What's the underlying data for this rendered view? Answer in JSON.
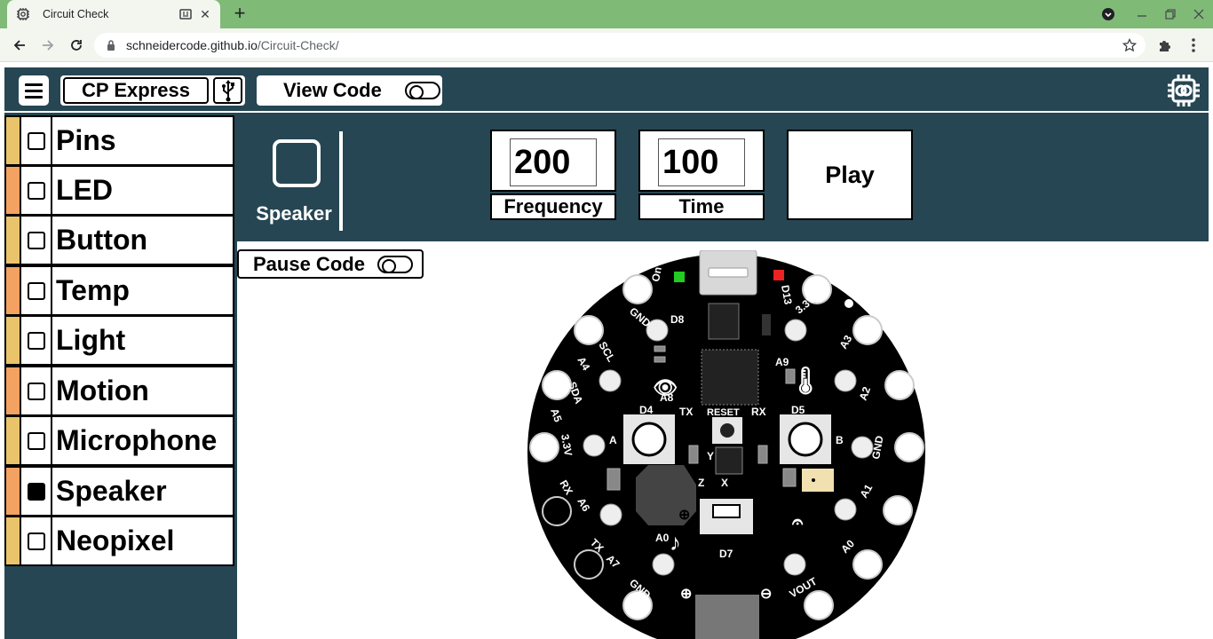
{
  "browser": {
    "tab_title": "Circuit Check",
    "url_host": "schneidercode.github.io",
    "url_path": "/Circuit-Check/"
  },
  "header": {
    "board_label": "CP Express",
    "view_code_label": "View Code",
    "view_code_on": false
  },
  "sidebar": {
    "items": [
      {
        "label": "Pins",
        "checked": false,
        "strip": "#e9c46a"
      },
      {
        "label": "LED",
        "checked": false,
        "strip": "#f4a261"
      },
      {
        "label": "Button",
        "checked": false,
        "strip": "#e9c46a"
      },
      {
        "label": "Temp",
        "checked": false,
        "strip": "#f4a261"
      },
      {
        "label": "Light",
        "checked": false,
        "strip": "#e9c46a"
      },
      {
        "label": "Motion",
        "checked": false,
        "strip": "#f4a261"
      },
      {
        "label": "Microphone",
        "checked": false,
        "strip": "#e9c46a"
      },
      {
        "label": "Speaker",
        "checked": true,
        "strip": "#f4a261"
      },
      {
        "label": "Neopixel",
        "checked": false,
        "strip": "#e9c46a"
      }
    ]
  },
  "speaker_panel": {
    "title": "Speaker",
    "frequency_value": "200",
    "frequency_label": "Frequency",
    "time_value": "100",
    "time_label": "Time",
    "play_label": "Play"
  },
  "main": {
    "pause_code_label": "Pause Code",
    "pause_code_on": false
  },
  "board": {
    "labels": {
      "on": "On",
      "d13": "D13",
      "gnd_top": "GND",
      "d8": "D8",
      "v33_top": "3.3V",
      "scl": "SCL",
      "a4": "A4",
      "a3": "A3",
      "a9": "A9",
      "sda": "SDA",
      "a5": "A5",
      "a8": "A8",
      "a2": "A2",
      "d4": "D4",
      "tx": "TX",
      "reset": "RESET",
      "rx": "RX",
      "d5": "D5",
      "v33_left": "3.3V",
      "btn_a": "A",
      "btn_b": "B",
      "gnd_right": "GND",
      "axis_y": "Y",
      "axis_z": "Z",
      "axis_x": "X",
      "rx_low": "RX",
      "a6": "A6",
      "a1": "A1",
      "tx_low": "TX",
      "a7": "A7",
      "a0_center": "A0",
      "d7": "D7",
      "a0_right": "A0",
      "gnd_bottom": "GND",
      "vout": "VOUT"
    },
    "colors": {
      "pcb": "#000000",
      "led_green": "#22cc22",
      "led_red": "#ee2222",
      "accent": "#264653"
    }
  }
}
